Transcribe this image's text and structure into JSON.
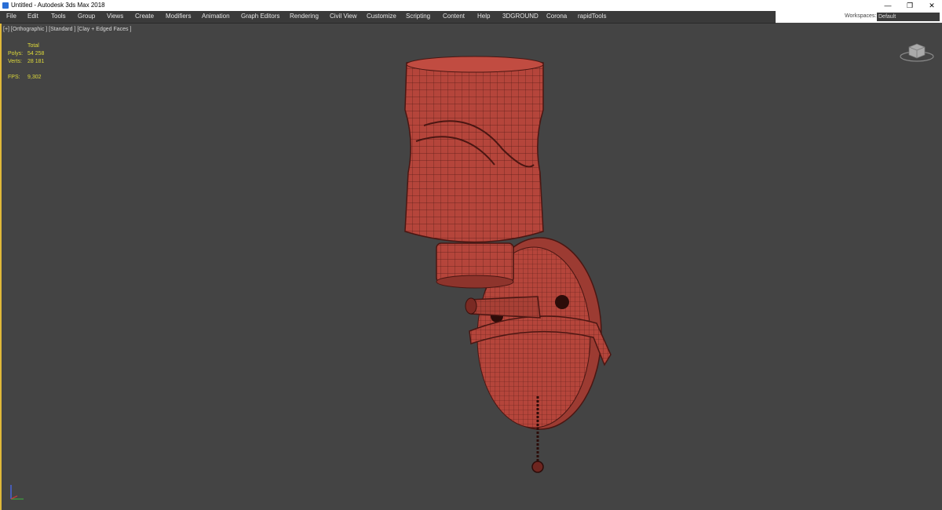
{
  "window": {
    "title": "Untitled - Autodesk 3ds Max 2018",
    "minimize": "—",
    "restore": "❐",
    "close": "✕"
  },
  "menu": [
    "File",
    "Edit",
    "Tools",
    "Group",
    "Views",
    "Create",
    "Modifiers",
    "Animation",
    "Graph Editors",
    "Rendering",
    "Civil View",
    "Customize",
    "Scripting",
    "Content",
    "Help",
    "3DGROUND",
    "Corona",
    "rapidTools"
  ],
  "workspace": {
    "label": "Workspaces:",
    "value": "Default"
  },
  "viewport": {
    "label": "[+] [Orthographic ] [Standard ] [Clay + Edged Faces ]",
    "stats": {
      "header": "Total",
      "polys_label": "Polys:",
      "polys_value": "54 258",
      "verts_label": "Verts:",
      "verts_value": "28 181",
      "fps_label": "FPS:",
      "fps_value": "9,302"
    }
  },
  "colors": {
    "accent": "#e0b93a",
    "mesh": "#b5453b",
    "background": "#444444",
    "stats": "#ddd93a"
  }
}
